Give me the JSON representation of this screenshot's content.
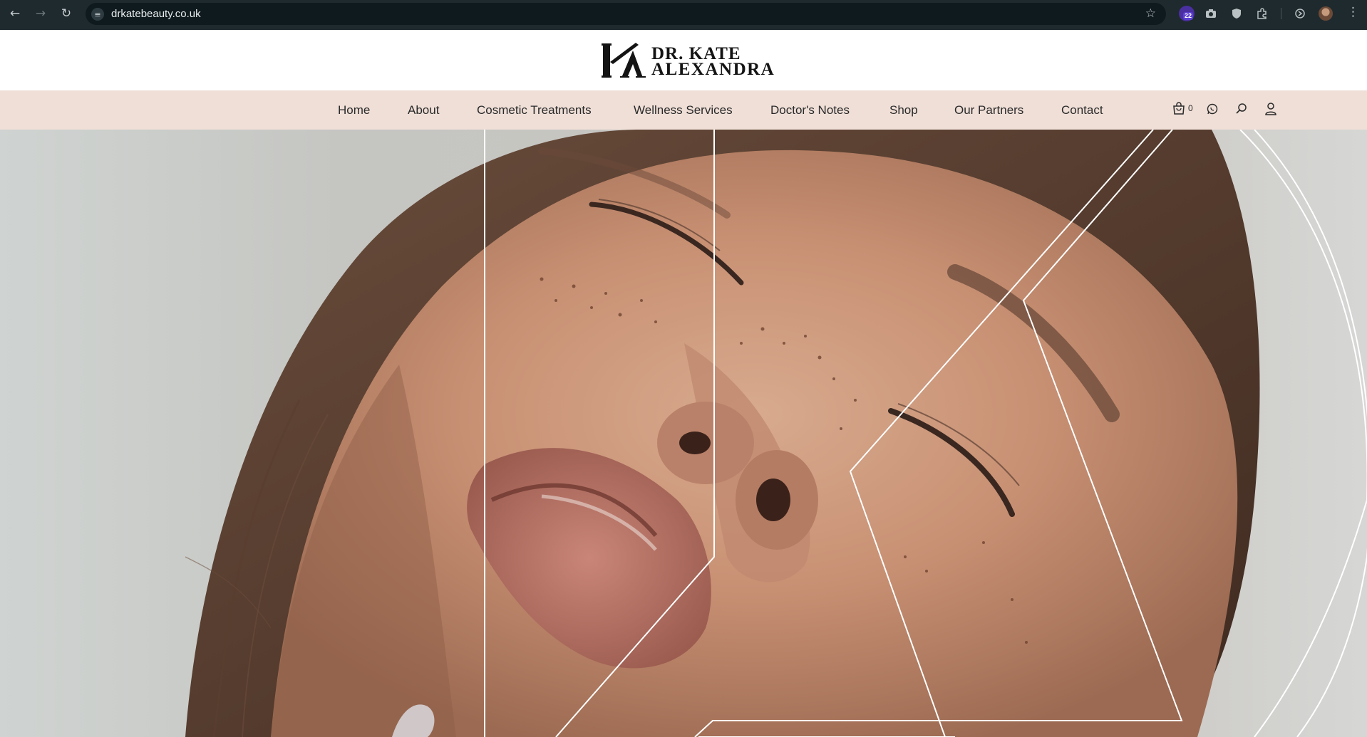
{
  "browser": {
    "url": "drkatebeauty.co.uk",
    "extension_badge": "22",
    "icons": [
      "back-arrow-icon",
      "forward-arrow-icon",
      "reload-icon",
      "site-settings-icon",
      "bookmark-star-icon",
      "extension-icon",
      "camera-icon",
      "shield-icon",
      "puzzle-icon",
      "refresh-circle-icon",
      "profile-avatar",
      "more-vertical-icon"
    ]
  },
  "brand": {
    "line1": "DR. KATE",
    "line2": "ALEXANDRA",
    "monogram": "KA"
  },
  "nav": {
    "items": [
      {
        "label": "Home"
      },
      {
        "label": "About"
      },
      {
        "label": "Cosmetic Treatments"
      },
      {
        "label": "Wellness Services"
      },
      {
        "label": "Doctor's Notes"
      },
      {
        "label": "Shop"
      },
      {
        "label": "Our Partners"
      },
      {
        "label": "Contact"
      }
    ],
    "cart_count": "0",
    "icons": [
      "cart-icon",
      "whatsapp-icon",
      "search-icon",
      "account-icon"
    ]
  },
  "colors": {
    "browser_bar": "#1f2a2e",
    "nav_background": "#efdfd7",
    "header_background": "#ffffff",
    "text": "#2a2a2a"
  }
}
